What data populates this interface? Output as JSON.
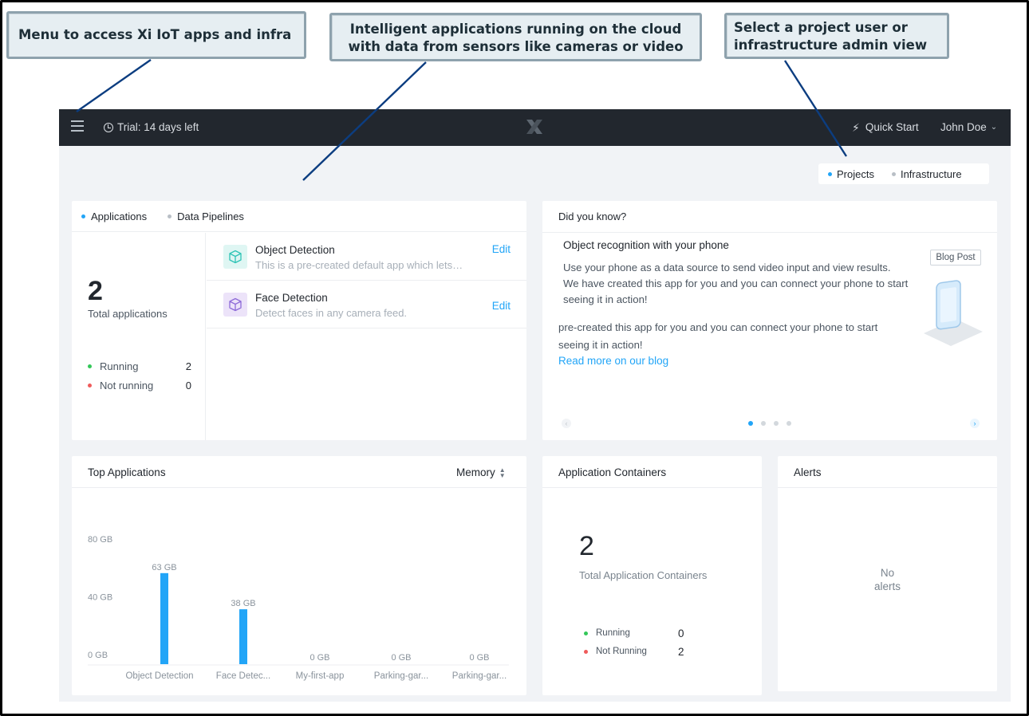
{
  "callouts": {
    "menu": "Menu to access Xi IoT apps and infra",
    "apps_line1": "Intelligent applications running on the cloud",
    "apps_line2": "with data from sensors like cameras or video",
    "view_line1": "Select a project user or",
    "view_line2": "infrastructure admin view"
  },
  "topbar": {
    "trial": "Trial: 14 days left",
    "quick_start": "Quick Start",
    "user": "John Doe",
    "icons": [
      "menu-icon",
      "clock-icon",
      "x-logo",
      "bolt-icon",
      "chevron-down-icon"
    ]
  },
  "view_switcher": {
    "projects": "Projects",
    "infrastructure": "Infrastructure",
    "selected": "Projects"
  },
  "applications_card": {
    "tabs": [
      "Applications",
      "Data Pipelines"
    ],
    "total": "2",
    "total_label": "Total applications",
    "running_label": "Running",
    "running": "2",
    "not_running_label": "Not running",
    "not_running": "0",
    "apps": [
      {
        "name": "Object Detection",
        "description": "This is a pre-created default app which lets…",
        "action": "Edit",
        "icon": "cube-icon",
        "color": "#2ec4b6"
      },
      {
        "name": "Face Detection",
        "description": "Detect faces in any camera feed.",
        "action": "Edit",
        "icon": "cube-icon",
        "color": "#8e6bd8"
      }
    ]
  },
  "did_you_know": {
    "title": "Did you know?",
    "headline": "Object recognition with your phone",
    "body_line1": "Use your phone as a data source to send video input and view results.",
    "body_line2": "We have created this app for you and you can connect your phone to start",
    "body_line3": "seeing it in action!",
    "body2_line1": "pre-created this app for you and you can connect your phone to start",
    "body2_line2": "seeing it in action!",
    "link": "Read more on our blog",
    "badge": "Blog Post",
    "carousel_pages": 4,
    "carousel_active": 1
  },
  "top_applications": {
    "title": "Top Applications",
    "metric": "Memory"
  },
  "chart_data": {
    "type": "bar",
    "title": "Top Applications",
    "xlabel": "",
    "ylabel": "",
    "categories": [
      "Object Detection",
      "Face Detec...",
      "My-first-app",
      "Parking-gar...",
      "Parking-gar..."
    ],
    "values": [
      63,
      38,
      0,
      0,
      0
    ],
    "data_labels": [
      "63 GB",
      "38 GB",
      "0 GB",
      "0 GB",
      "0 GB"
    ],
    "y_ticks": [
      "80 GB",
      "40 GB",
      "0 GB"
    ],
    "y_tick_values": [
      80,
      40,
      0
    ],
    "ylim": [
      0,
      80
    ],
    "grid": false,
    "bar_color": "#22a5f7"
  },
  "containers": {
    "title": "Application Containers",
    "total": "2",
    "total_label": "Total Application Containers",
    "running_label": "Running",
    "running": "0",
    "not_running_label": "Not Running",
    "not_running": "2"
  },
  "alerts": {
    "title": "Alerts",
    "empty_line1": "No",
    "empty_line2": "alerts"
  },
  "colors": {
    "accent": "#22a5f7",
    "topbar": "#22272e",
    "background": "#f1f3f6",
    "running": "#34c759",
    "not_running": "#ef5b5b"
  }
}
